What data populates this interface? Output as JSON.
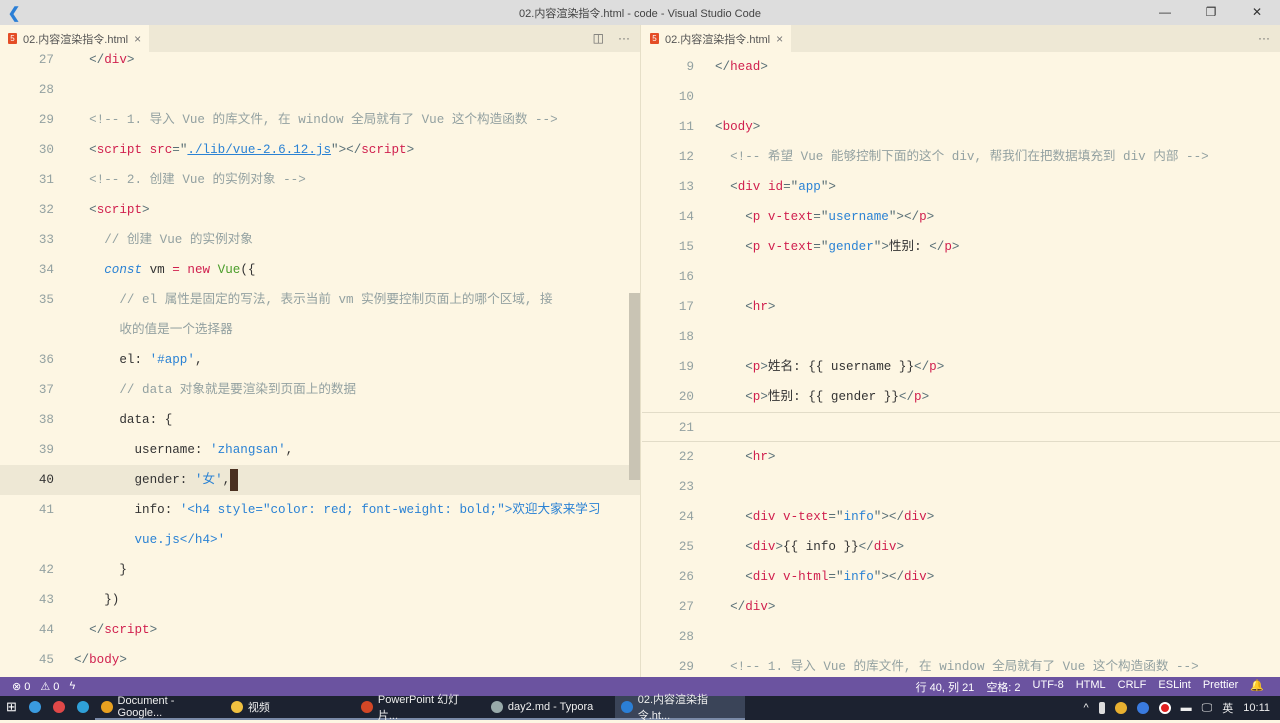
{
  "window": {
    "title": "02.内容渲染指令.html - code - Visual Studio Code",
    "minimize": "—",
    "maximize": "❐",
    "close": "✕"
  },
  "left": {
    "tab": "02.内容渲染指令.html",
    "close": "×",
    "split": "◫",
    "more": "···",
    "lines": [
      {
        "n": "27",
        "t": [
          [
            "t-p",
            "  </"
          ],
          [
            "t-tag",
            "div"
          ],
          [
            "t-p",
            ">"
          ]
        ]
      },
      {
        "n": "28",
        "t": []
      },
      {
        "n": "29",
        "t": [
          [
            "t-com",
            "  <!-- 1. 导入 Vue 的库文件, 在 window 全局就有了 Vue 这个构造函数 -->"
          ]
        ]
      },
      {
        "n": "30",
        "t": [
          [
            "t-p",
            "  <"
          ],
          [
            "t-tag",
            "script"
          ],
          [
            "t-p",
            " "
          ],
          [
            "t-attr",
            "src"
          ],
          [
            "t-p",
            "=\""
          ],
          [
            "t-url",
            "./lib/vue-2.6.12.js"
          ],
          [
            "t-p",
            "\"></"
          ],
          [
            "t-tag",
            "script"
          ],
          [
            "t-p",
            ">"
          ]
        ]
      },
      {
        "n": "31",
        "t": [
          [
            "t-com",
            "  <!-- 2. 创建 Vue 的实例对象 -->"
          ]
        ]
      },
      {
        "n": "32",
        "t": [
          [
            "t-p",
            "  <"
          ],
          [
            "t-tag",
            "script"
          ],
          [
            "t-p",
            ">"
          ]
        ]
      },
      {
        "n": "33",
        "t": [
          [
            "t-com",
            "    // 创建 Vue 的实例对象"
          ]
        ]
      },
      {
        "n": "34",
        "t": [
          [
            "t-p",
            "    "
          ],
          [
            "t-kw",
            "const"
          ],
          [
            "t-id",
            " vm "
          ],
          [
            "t-new",
            "="
          ],
          [
            "t-p",
            " "
          ],
          [
            "t-new",
            "new"
          ],
          [
            "t-p",
            " "
          ],
          [
            "t-cls",
            "Vue"
          ],
          [
            "t-id",
            "({"
          ]
        ]
      },
      {
        "n": "35",
        "t": [
          [
            "t-com",
            "      // el 属性是固定的写法, 表示当前 vm 实例要控制页面上的哪个区域, 接"
          ]
        ]
      },
      {
        "n": "",
        "t": [
          [
            "t-com",
            "      收的值是一个选择器"
          ]
        ]
      },
      {
        "n": "36",
        "t": [
          [
            "t-id",
            "      el: "
          ],
          [
            "t-str",
            "'#app'"
          ],
          [
            "t-id",
            ","
          ]
        ]
      },
      {
        "n": "37",
        "t": [
          [
            "t-com",
            "      // data 对象就是要渲染到页面上的数据"
          ]
        ]
      },
      {
        "n": "38",
        "t": [
          [
            "t-id",
            "      data: {"
          ]
        ]
      },
      {
        "n": "39",
        "t": [
          [
            "t-id",
            "        username: "
          ],
          [
            "t-str",
            "'zhangsan'"
          ],
          [
            "t-id",
            ","
          ]
        ]
      },
      {
        "n": "40",
        "cur": true,
        "t": [
          [
            "t-id",
            "        gender: "
          ],
          [
            "t-str",
            "'女'"
          ],
          [
            "t-id",
            ","
          ]
        ]
      },
      {
        "n": "41",
        "t": [
          [
            "t-id",
            "        info: "
          ],
          [
            "t-str",
            "'<h4 style=\"color: red; font-weight: bold;\">欢迎大家来学习"
          ]
        ]
      },
      {
        "n": "",
        "t": [
          [
            "t-str",
            "        vue.js</h4>'"
          ]
        ]
      },
      {
        "n": "42",
        "t": [
          [
            "t-id",
            "      }"
          ]
        ]
      },
      {
        "n": "43",
        "t": [
          [
            "t-id",
            "    })"
          ]
        ]
      },
      {
        "n": "44",
        "t": [
          [
            "t-p",
            "  </"
          ],
          [
            "t-tag",
            "script"
          ],
          [
            "t-p",
            ">"
          ]
        ]
      },
      {
        "n": "45",
        "t": [
          [
            "t-p",
            "</"
          ],
          [
            "t-tag",
            "body"
          ],
          [
            "t-p",
            ">"
          ]
        ]
      }
    ]
  },
  "right": {
    "tab": "02.内容渲染指令.html",
    "close": "×",
    "more": "···",
    "lines": [
      {
        "n": "9",
        "t": [
          [
            "t-p",
            "</"
          ],
          [
            "t-tag",
            "head"
          ],
          [
            "t-p",
            ">"
          ]
        ]
      },
      {
        "n": "10",
        "t": []
      },
      {
        "n": "11",
        "t": [
          [
            "t-p",
            "<"
          ],
          [
            "t-tag",
            "body"
          ],
          [
            "t-p",
            ">"
          ]
        ]
      },
      {
        "n": "12",
        "t": [
          [
            "t-com",
            "  <!-- 希望 Vue 能够控制下面的这个 div, 帮我们在把数据填充到 div 内部 -->"
          ]
        ]
      },
      {
        "n": "13",
        "t": [
          [
            "t-p",
            "  <"
          ],
          [
            "t-tag",
            "div"
          ],
          [
            "t-p",
            " "
          ],
          [
            "t-attr",
            "id"
          ],
          [
            "t-p",
            "=\""
          ],
          [
            "t-str",
            "app"
          ],
          [
            "t-p",
            "\">"
          ]
        ]
      },
      {
        "n": "14",
        "t": [
          [
            "t-p",
            "    <"
          ],
          [
            "t-tag",
            "p"
          ],
          [
            "t-p",
            " "
          ],
          [
            "t-attr",
            "v-text"
          ],
          [
            "t-p",
            "=\""
          ],
          [
            "t-str",
            "username"
          ],
          [
            "t-p",
            "\"></"
          ],
          [
            "t-tag",
            "p"
          ],
          [
            "t-p",
            ">"
          ]
        ]
      },
      {
        "n": "15",
        "t": [
          [
            "t-p",
            "    <"
          ],
          [
            "t-tag",
            "p"
          ],
          [
            "t-p",
            " "
          ],
          [
            "t-attr",
            "v-text"
          ],
          [
            "t-p",
            "=\""
          ],
          [
            "t-str",
            "gender"
          ],
          [
            "t-p",
            "\">"
          ],
          [
            "t-id",
            "性别: "
          ],
          [
            "t-p",
            "</"
          ],
          [
            "t-tag",
            "p"
          ],
          [
            "t-p",
            ">"
          ]
        ]
      },
      {
        "n": "16",
        "t": []
      },
      {
        "n": "17",
        "t": [
          [
            "t-p",
            "    <"
          ],
          [
            "t-tag",
            "hr"
          ],
          [
            "t-p",
            ">"
          ]
        ]
      },
      {
        "n": "18",
        "t": []
      },
      {
        "n": "19",
        "t": [
          [
            "t-p",
            "    <"
          ],
          [
            "t-tag",
            "p"
          ],
          [
            "t-p",
            ">"
          ],
          [
            "t-id",
            "姓名: {{ username }}"
          ],
          [
            "t-p",
            "</"
          ],
          [
            "t-tag",
            "p"
          ],
          [
            "t-p",
            ">"
          ]
        ]
      },
      {
        "n": "20",
        "t": [
          [
            "t-p",
            "    <"
          ],
          [
            "t-tag",
            "p"
          ],
          [
            "t-p",
            ">"
          ],
          [
            "t-id",
            "性别: {{ gender }}"
          ],
          [
            "t-p",
            "</"
          ],
          [
            "t-tag",
            "p"
          ],
          [
            "t-p",
            ">"
          ]
        ]
      },
      {
        "n": "21",
        "hl": true,
        "t": []
      },
      {
        "n": "22",
        "t": [
          [
            "t-p",
            "    <"
          ],
          [
            "t-tag",
            "hr"
          ],
          [
            "t-p",
            ">"
          ]
        ]
      },
      {
        "n": "23",
        "t": []
      },
      {
        "n": "24",
        "t": [
          [
            "t-p",
            "    <"
          ],
          [
            "t-tag",
            "div"
          ],
          [
            "t-p",
            " "
          ],
          [
            "t-attr",
            "v-text"
          ],
          [
            "t-p",
            "=\""
          ],
          [
            "t-str",
            "info"
          ],
          [
            "t-p",
            "\"></"
          ],
          [
            "t-tag",
            "div"
          ],
          [
            "t-p",
            ">"
          ]
        ]
      },
      {
        "n": "25",
        "t": [
          [
            "t-p",
            "    <"
          ],
          [
            "t-tag",
            "div"
          ],
          [
            "t-p",
            ">"
          ],
          [
            "t-id",
            "{{ info }}"
          ],
          [
            "t-p",
            "</"
          ],
          [
            "t-tag",
            "div"
          ],
          [
            "t-p",
            ">"
          ]
        ]
      },
      {
        "n": "26",
        "t": [
          [
            "t-p",
            "    <"
          ],
          [
            "t-tag",
            "div"
          ],
          [
            "t-p",
            " "
          ],
          [
            "t-attr",
            "v-html"
          ],
          [
            "t-p",
            "=\""
          ],
          [
            "t-str",
            "info"
          ],
          [
            "t-p",
            "\"></"
          ],
          [
            "t-tag",
            "div"
          ],
          [
            "t-p",
            ">"
          ]
        ]
      },
      {
        "n": "27",
        "t": [
          [
            "t-p",
            "  </"
          ],
          [
            "t-tag",
            "div"
          ],
          [
            "t-p",
            ">"
          ]
        ]
      },
      {
        "n": "28",
        "t": []
      },
      {
        "n": "29",
        "t": [
          [
            "t-com",
            "  <!-- 1. 导入 Vue 的库文件, 在 window 全局就有了 Vue 这个构造函数 -->"
          ]
        ]
      }
    ]
  },
  "status": {
    "errors": "⊗ 0",
    "warnings": "⚠ 0",
    "sync": "ϟ",
    "position": "行 40, 列 21",
    "spaces": "空格: 2",
    "encoding": "UTF-8",
    "language": "HTML",
    "eol": "CRLF",
    "lint": "ESLint",
    "prettier": "Prettier",
    "bell": "🔔"
  },
  "taskbar": {
    "items": [
      {
        "label": "",
        "icon": "#3a9be0"
      },
      {
        "label": "",
        "icon": "#e04848"
      },
      {
        "label": "",
        "icon": "#2fa0d8"
      },
      {
        "label": "Document - Google...",
        "icon": "#e8a020"
      },
      {
        "label": "视频",
        "icon": "#f0c040"
      },
      {
        "label": "PowerPoint 幻灯片...",
        "icon": "#d24726"
      },
      {
        "label": "day2.md - Typora",
        "icon": "#9aa"
      },
      {
        "label": "02.内容渲染指令.ht...",
        "icon": "#2b7fd6"
      }
    ],
    "tray_ime": "英",
    "time": "10:11",
    "tray_up": "^"
  }
}
